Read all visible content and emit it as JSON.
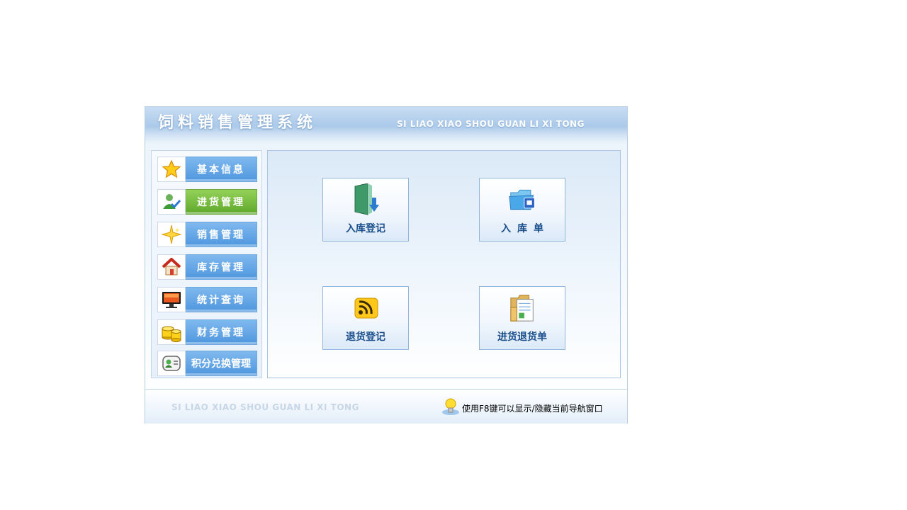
{
  "app": {
    "title": "饲料销售管理系统",
    "subtitle": "SI LIAO XIAO SHOU GUAN LI XI TONG"
  },
  "sidebar": {
    "items": [
      {
        "label": "基本信息",
        "icon": "star-icon",
        "active": false
      },
      {
        "label": "进货管理",
        "icon": "user-check-icon",
        "active": true
      },
      {
        "label": "销售管理",
        "icon": "sparkle-star-icon",
        "active": false
      },
      {
        "label": "库存管理",
        "icon": "house-icon",
        "active": false
      },
      {
        "label": "统计查询",
        "icon": "monitor-icon",
        "active": false
      },
      {
        "label": "财务管理",
        "icon": "coins-icon",
        "active": false
      },
      {
        "label": "积分兑换管理",
        "icon": "contact-card-icon",
        "active": false
      }
    ]
  },
  "main": {
    "tiles": [
      {
        "label": "入库登记",
        "icon": "door-download-icon"
      },
      {
        "label": "入库单",
        "icon": "folder-note-icon"
      },
      {
        "label": "退货登记",
        "icon": "rss-icon"
      },
      {
        "label": "进货退货单",
        "icon": "folder-document-icon"
      }
    ]
  },
  "footer": {
    "brand": "SI LIAO XIAO SHOU GUAN LI XI TONG",
    "hint": "使用F8键可以显示/隐藏当前导航窗口",
    "hint_icon": "lightbulb-icon"
  },
  "colors": {
    "nav_blue": "#4f97df",
    "nav_active_green": "#5ea82a",
    "tile_text": "#1a4f8c"
  }
}
